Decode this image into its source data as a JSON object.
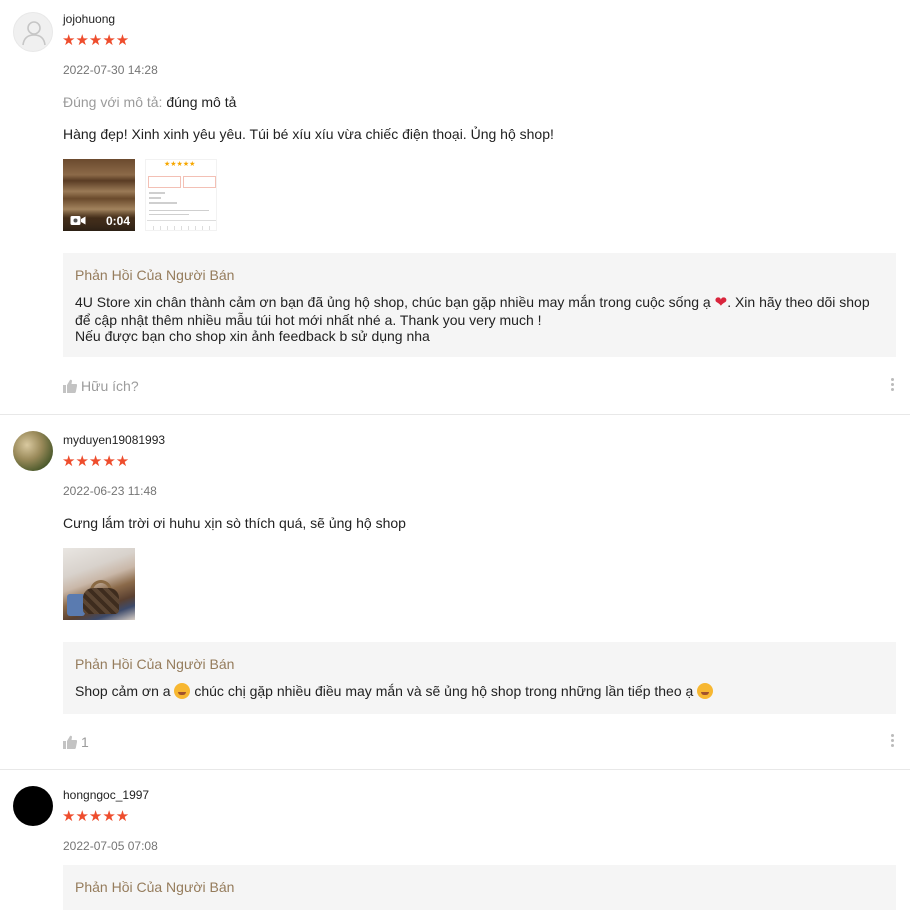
{
  "reviews": [
    {
      "username": "jojohuong",
      "stars": "★★★★★",
      "date": "2022-07-30 14:28",
      "attr_key": "Đúng với mô tả:",
      "attr_value": "đúng mô tả",
      "comment": "Hàng đẹp! Xinh xinh yêu yêu. Túi bé xíu xíu vừa chiếc điện thoại. Ủng hộ shop!",
      "video_duration": "0:04",
      "reply_title": "Phản Hồi Của Người Bán",
      "reply_line1a": "4U Store xin chân thành cảm ơn bạn đã ủng hộ shop, chúc bạn gặp nhiều may mắn trong cuộc sống ạ",
      "reply_heart": "❤",
      "reply_line1b": ". Xin hãy theo dõi shop",
      "reply_line2": "để cập nhật thêm nhiều mẫu túi hot mới nhất nhé a. Thank you very much !",
      "reply_line3": "Nếu được bạn cho shop xin ảnh feedback b sử dụng nha",
      "helpful_label": "Hữu ích?"
    },
    {
      "username": "myduyen19081993",
      "stars": "★★★★★",
      "date": "2022-06-23 11:48",
      "comment": "Cưng lắm trời ơi huhu xịn sò thích quá, sẽ ủng hộ shop",
      "reply_title": "Phản Hồi Của Người Bán",
      "reply_part1": "Shop cảm ơn a",
      "reply_part2": "chúc chị gặp nhiều điều may mắn và sẽ ủng hộ shop trong những lần tiếp theo ạ",
      "helpful_count": "1"
    },
    {
      "username": "hongngoc_1997",
      "stars": "★★★★★",
      "date": "2022-07-05 07:08",
      "reply_title": "Phản Hồi Của Người Bán"
    }
  ],
  "icons": {
    "star": "star-icon",
    "thumb": "thumbs-up-icon",
    "more": "more-vertical-icon",
    "camera": "video-camera-icon"
  },
  "colors": {
    "star": "#ee4d2d",
    "reply_title": "#957c5c",
    "reply_bg": "#f5f5f5"
  }
}
